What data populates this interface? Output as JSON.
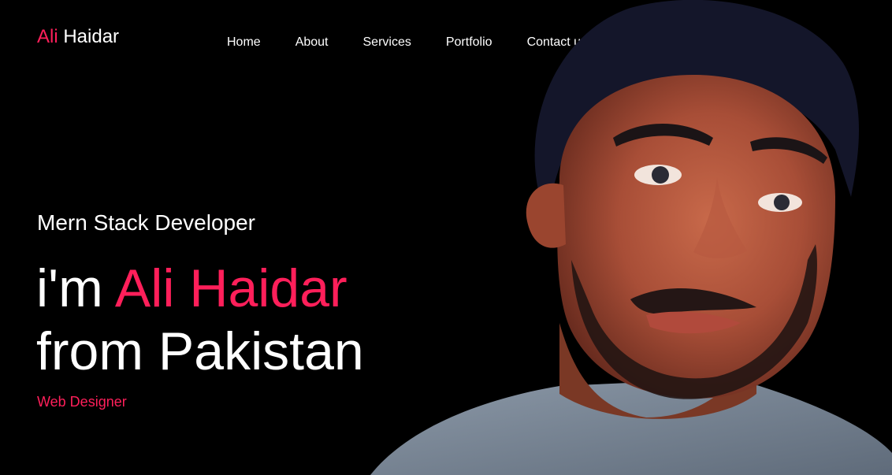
{
  "header": {
    "logo_first": "Ali",
    "logo_second": "Haidar"
  },
  "nav": {
    "items": [
      {
        "label": "Home"
      },
      {
        "label": "About"
      },
      {
        "label": "Services"
      },
      {
        "label": "Portfolio"
      },
      {
        "label": "Contact us"
      }
    ]
  },
  "hero": {
    "subtitle": "Mern Stack Developer",
    "headline_prefix": "i'm",
    "headline_name": "Ali Haidar",
    "headline_line2": "from Pakistan",
    "role": "Web Designer"
  },
  "colors": {
    "background": "#000000",
    "accent": "#ff1f5a",
    "text": "#ffffff"
  },
  "image": {
    "subject": "portrait-photo"
  }
}
